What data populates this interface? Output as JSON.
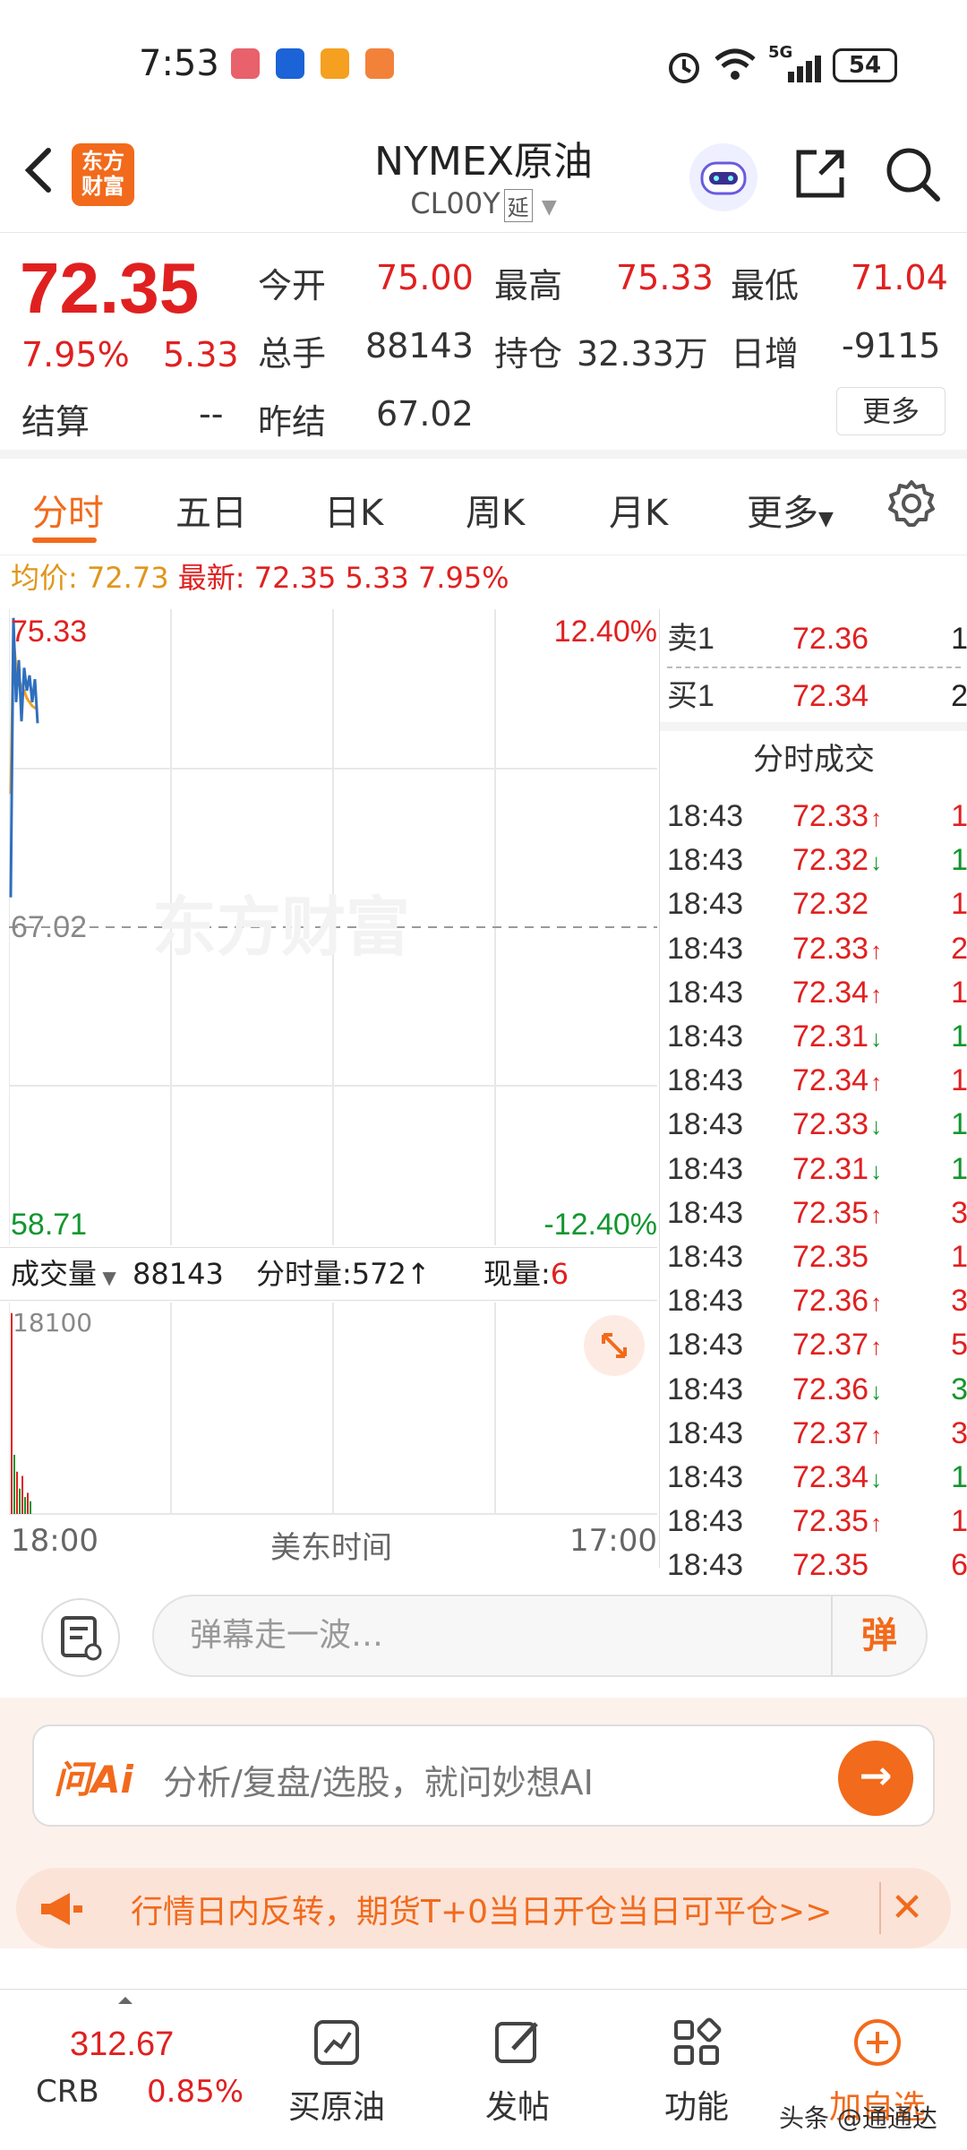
{
  "status_bar": {
    "time": "7:53",
    "battery": "54",
    "network": "5G"
  },
  "header": {
    "logo_line1": "东方",
    "logo_line2": "财富",
    "title": "NYMEX原油",
    "code": "CL00Y",
    "code_tag": "延"
  },
  "quote": {
    "price": "72.35",
    "change_pct": "7.95%",
    "change": "5.33",
    "open_label": "今开",
    "open": "75.00",
    "high_label": "最高",
    "high": "75.33",
    "low_label": "最低",
    "low": "71.04",
    "volume_label": "总手",
    "volume": "88143",
    "oi_label": "持仓",
    "oi": "32.33万",
    "daily_inc_label": "日增",
    "daily_inc": "-9115",
    "settle_label": "结算",
    "settle": "--",
    "prev_settle_label": "昨结",
    "prev_settle": "67.02",
    "more_label": "更多"
  },
  "tabs": [
    {
      "label": "分时"
    },
    {
      "label": "五日"
    },
    {
      "label": "日K"
    },
    {
      "label": "周K"
    },
    {
      "label": "月K"
    },
    {
      "label": "更多"
    }
  ],
  "infoline": {
    "avg_label": "均价:",
    "avg": "72.73",
    "latest_label": "最新:",
    "latest": "72.35",
    "change": "5.33",
    "pct": "7.95%"
  },
  "chart": {
    "top_price": "75.33",
    "top_pct": "12.40%",
    "mid_price": "67.02",
    "bottom_price": "58.71",
    "bottom_pct": "-12.40%",
    "volume_label": "成交量",
    "volume": "88143",
    "tick_volume_label": "分时量:",
    "tick_volume": "572↑",
    "now_vol_label": "现量:",
    "now_vol": "6",
    "vol_max": "18100",
    "start_time": "18:00",
    "mid_label": "美东时间",
    "end_time": "17:00"
  },
  "chart_data": {
    "type": "line",
    "title": "",
    "ylim": [
      58.71,
      75.33
    ],
    "series": [
      {
        "values": [
          67.8,
          75.1,
          72.9,
          74.0,
          72.4,
          73.8,
          73.2,
          73.6,
          72.9,
          73.5,
          72.35
        ]
      },
      {
        "values": [
          70.5,
          74.6,
          73.8,
          73.5,
          73.3,
          73.2,
          73.0,
          72.9,
          72.8,
          72.75,
          72.73
        ]
      }
    ],
    "colors": {
      "price_line": "#2f6fbe",
      "avg_line": "#f0a020",
      "up": "#e02020",
      "down": "#12962f"
    }
  },
  "orderbook": {
    "sell1_label": "卖1",
    "sell1_price": "72.36",
    "sell1_vol": "1",
    "buy1_label": "买1",
    "buy1_price": "72.34",
    "buy1_vol": "2",
    "trades_title": "分时成交",
    "trades": [
      {
        "time": "18:43",
        "price": "72.33",
        "dir": "↑",
        "vol": "1"
      },
      {
        "time": "18:43",
        "price": "72.32",
        "dir": "↓",
        "vol": "1"
      },
      {
        "time": "18:43",
        "price": "72.32",
        "dir": "",
        "vol": "1"
      },
      {
        "time": "18:43",
        "price": "72.33",
        "dir": "↑",
        "vol": "2"
      },
      {
        "time": "18:43",
        "price": "72.34",
        "dir": "↑",
        "vol": "1"
      },
      {
        "time": "18:43",
        "price": "72.31",
        "dir": "↓",
        "vol": "1"
      },
      {
        "time": "18:43",
        "price": "72.34",
        "dir": "↑",
        "vol": "1"
      },
      {
        "time": "18:43",
        "price": "72.33",
        "dir": "↓",
        "vol": "1"
      },
      {
        "time": "18:43",
        "price": "72.31",
        "dir": "↓",
        "vol": "1"
      },
      {
        "time": "18:43",
        "price": "72.35",
        "dir": "↑",
        "vol": "3"
      },
      {
        "time": "18:43",
        "price": "72.35",
        "dir": "",
        "vol": "1"
      },
      {
        "time": "18:43",
        "price": "72.36",
        "dir": "↑",
        "vol": "3"
      },
      {
        "time": "18:43",
        "price": "72.37",
        "dir": "↑",
        "vol": "5"
      },
      {
        "time": "18:43",
        "price": "72.36",
        "dir": "↓",
        "vol": "3"
      },
      {
        "time": "18:43",
        "price": "72.37",
        "dir": "↑",
        "vol": "3"
      },
      {
        "time": "18:43",
        "price": "72.34",
        "dir": "↓",
        "vol": "1"
      },
      {
        "time": "18:43",
        "price": "72.35",
        "dir": "↑",
        "vol": "1"
      },
      {
        "time": "18:43",
        "price": "72.35",
        "dir": "",
        "vol": "6"
      }
    ]
  },
  "comment": {
    "placeholder": "弹幕走一波…",
    "dan_label": "弹"
  },
  "ai": {
    "logo": "问Ai",
    "prompt": "分析/复盘/选股，就问妙想AI"
  },
  "promo": {
    "text": "行情日内反转，期货T+0当日开仓当日可平仓>>"
  },
  "bottom_nav": {
    "crb_value": "312.67",
    "crb_name": "CRB",
    "crb_pct": "0.85%",
    "items": [
      {
        "label": "买原油"
      },
      {
        "label": "发帖"
      },
      {
        "label": "功能"
      },
      {
        "label": "加自选"
      }
    ],
    "author": "头条 @通通达"
  }
}
